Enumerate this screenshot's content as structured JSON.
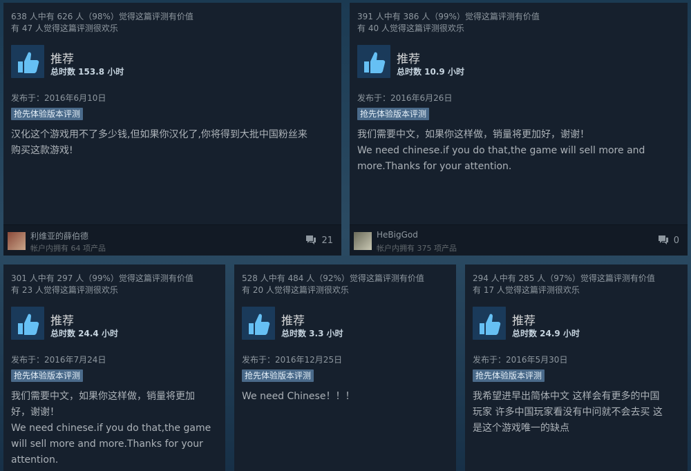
{
  "reviews": [
    {
      "helpful": "638 人中有 626 人（98%）觉得这篇评测有价值",
      "funny": "有 47 人觉得这篇评测很欢乐",
      "rec": "推荐",
      "hours": "总时数 153.8 小时",
      "posted": "发布于：2016年6月10日",
      "badge": "抢先体验版本评测",
      "body": "汉化这个游戏用不了多少钱,但如果你汉化了,你将得到大批中国粉丝来\n购买这款游戏!",
      "author": "利维亚的薛伯德",
      "products": "帐户内拥有 64 项产品",
      "comments": "21"
    },
    {
      "helpful": "391 人中有 386 人（99%）觉得这篇评测有价值",
      "funny": "有 40 人觉得这篇评测很欢乐",
      "rec": "推荐",
      "hours": "总时数 10.9 小时",
      "posted": "发布于：2016年6月26日",
      "badge": "抢先体验版本评测",
      "body": "我们需要中文，如果你这样做，销量将更加好，谢谢！\nWe need chinese.if you do that,the game will sell more and\nmore.Thanks for your attention.",
      "author": "HeBigGod",
      "products": "帐户内拥有 375 项产品",
      "comments": "0"
    },
    {
      "helpful": "301 人中有 297 人（99%）觉得这篇评测有价值",
      "funny": "有 23 人觉得这篇评测很欢乐",
      "rec": "推荐",
      "hours": "总时数 24.4 小时",
      "posted": "发布于：2016年7月24日",
      "badge": "抢先体验版本评测",
      "body": "我们需要中文，如果你这样做，销量将更加\n好，谢谢！\nWe need chinese.if you do that,the game\nwill sell more and more.Thanks for your\nattention."
    },
    {
      "helpful": "528 人中有 484 人（92%）觉得这篇评测有价值",
      "funny": "有 20 人觉得这篇评测很欢乐",
      "rec": "推荐",
      "hours": "总时数 3.3 小时",
      "posted": "发布于：2016年12月25日",
      "badge": "抢先体验版本评测",
      "body": "We need Chinese！！！"
    },
    {
      "helpful": "294 人中有 285 人（97%）觉得这篇评测有价值",
      "funny": "有 17 人觉得这篇评测很欢乐",
      "rec": "推荐",
      "hours": "总时数 24.9 小时",
      "posted": "发布于：2016年5月30日",
      "badge": "抢先体验版本评测",
      "body": "我希望进早出简体中文 这样会有更多的中国\n玩家 许多中国玩家看没有中问就不会去买 这\n是这个游戏唯一的缺点"
    }
  ],
  "colors": {
    "thumb_blue": "#66c0f4",
    "card_bg": "#16202d"
  }
}
